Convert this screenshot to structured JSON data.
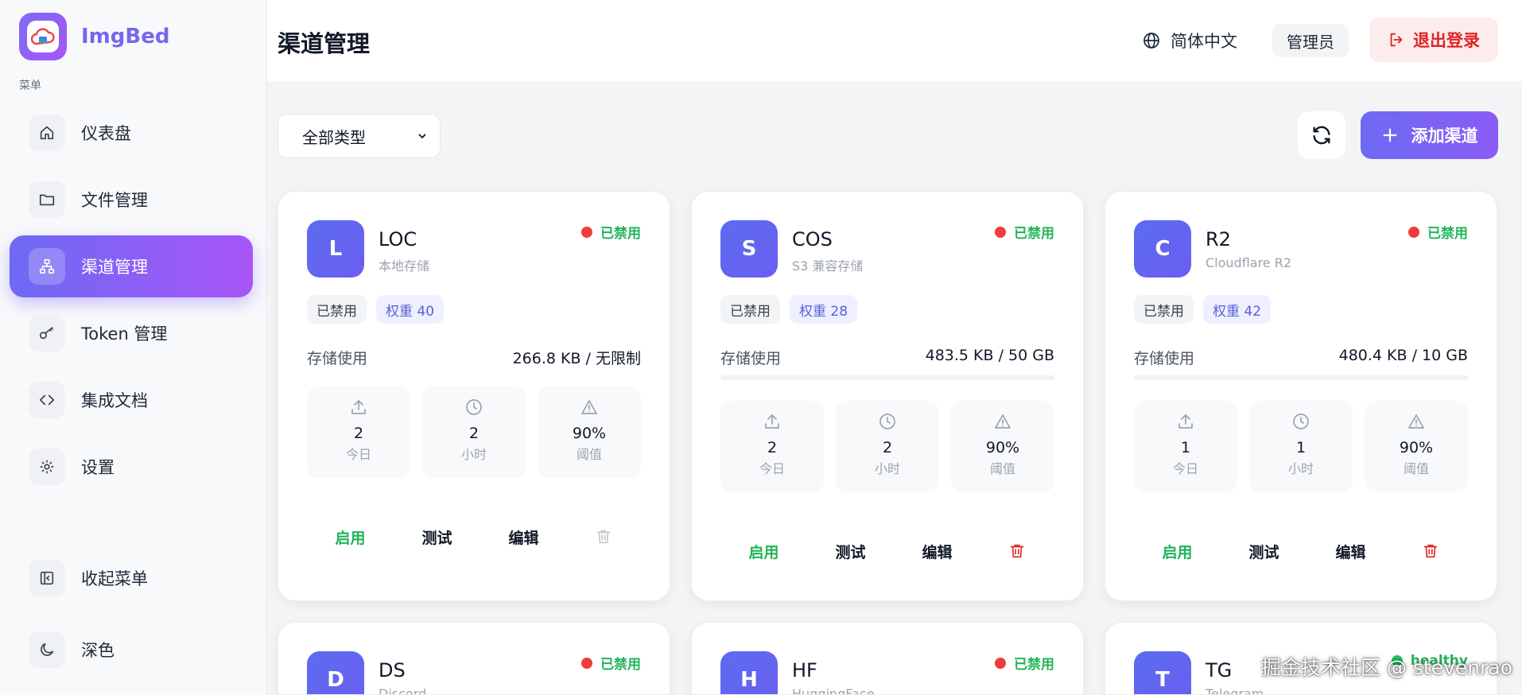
{
  "brand": {
    "name": "ImgBed"
  },
  "sidebar": {
    "menu_title": "菜单",
    "items": [
      {
        "label": "仪表盘",
        "icon": "home-icon"
      },
      {
        "label": "文件管理",
        "icon": "folder-icon"
      },
      {
        "label": "渠道管理",
        "icon": "network-icon",
        "active": true
      },
      {
        "label": "Token 管理",
        "icon": "key-icon"
      },
      {
        "label": "集成文档",
        "icon": "code-icon"
      },
      {
        "label": "设置",
        "icon": "gear-icon"
      }
    ],
    "bottom": [
      {
        "label": "收起菜单",
        "icon": "collapse-sidebar-icon"
      },
      {
        "label": "深色",
        "icon": "moon-icon"
      }
    ]
  },
  "header": {
    "title": "渠道管理",
    "language": "简体中文",
    "role": "管理员",
    "logout": "退出登录"
  },
  "toolbar": {
    "filter_value": "全部类型",
    "add_label": "添加渠道"
  },
  "colors": {
    "accent": "#6d6af3",
    "success": "#22b35a",
    "danger": "#ef3c3c"
  },
  "channels": [
    {
      "letter": "L",
      "name": "LOC",
      "subtitle": "本地存储",
      "status": "已禁用",
      "tag_state": "已禁用",
      "weight": "权重 40",
      "usage_label": "存储使用",
      "usage_value": "266.8 KB / 无限制",
      "usage_fraction": null,
      "stats": [
        {
          "value": "2",
          "label": "今日"
        },
        {
          "value": "2",
          "label": "小时"
        },
        {
          "value": "90%",
          "label": "阈值"
        }
      ],
      "actions": {
        "enable": "启用",
        "test": "测试",
        "edit": "编辑"
      },
      "delete_active": false
    },
    {
      "letter": "S",
      "name": "COS",
      "subtitle": "S3 兼容存储",
      "status": "已禁用",
      "tag_state": "已禁用",
      "weight": "权重 28",
      "usage_label": "存储使用",
      "usage_value": "483.5 KB / 50 GB",
      "usage_fraction": 0.0,
      "stats": [
        {
          "value": "2",
          "label": "今日"
        },
        {
          "value": "2",
          "label": "小时"
        },
        {
          "value": "90%",
          "label": "阈值"
        }
      ],
      "actions": {
        "enable": "启用",
        "test": "测试",
        "edit": "编辑"
      },
      "delete_active": true
    },
    {
      "letter": "C",
      "name": "R2",
      "subtitle": "Cloudflare R2",
      "status": "已禁用",
      "tag_state": "已禁用",
      "weight": "权重 42",
      "usage_label": "存储使用",
      "usage_value": "480.4 KB / 10 GB",
      "usage_fraction": 0.0,
      "stats": [
        {
          "value": "1",
          "label": "今日"
        },
        {
          "value": "1",
          "label": "小时"
        },
        {
          "value": "90%",
          "label": "阈值"
        }
      ],
      "actions": {
        "enable": "启用",
        "test": "测试",
        "edit": "编辑"
      },
      "delete_active": true
    },
    {
      "letter": "D",
      "name": "DS",
      "subtitle": "Discord",
      "status": "已禁用"
    },
    {
      "letter": "H",
      "name": "HF",
      "subtitle": "HuggingFace",
      "status": "已禁用"
    },
    {
      "letter": "T",
      "name": "TG",
      "subtitle": "Telegram",
      "status": "healthy"
    }
  ],
  "watermark": "掘金技术社区 @ stevenrao"
}
